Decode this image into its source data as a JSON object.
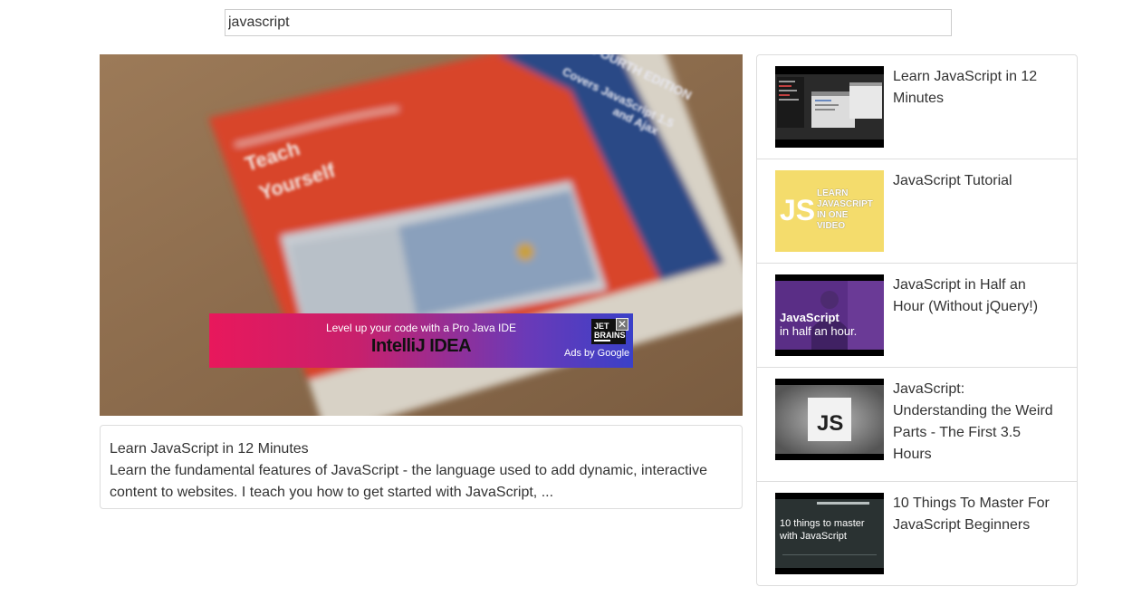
{
  "search": {
    "value": "javascript"
  },
  "player": {
    "ad": {
      "tagline": "Level up your code with a Pro Java IDE",
      "product": "IntelliJ IDEA",
      "logo_line1": "JET",
      "logo_line2": "BRAINS",
      "close_glyph": "✕",
      "attribution": "Ads by Google"
    },
    "book_text": {
      "edition": "FOURTH EDITION",
      "covers_line1": "Covers JavaScript 1.5",
      "covers_line2": "and Ajax",
      "teach": "Teach",
      "yourself": "Yourself"
    }
  },
  "selected_video": {
    "title": "Learn JavaScript in 12 Minutes",
    "description": "Learn the fundamental features of JavaScript - the language used to add dynamic, interactive content to websites. I teach you how to get started with JavaScript, ..."
  },
  "video_list": [
    {
      "title": "Learn JavaScript in 12 Minutes",
      "thumb": "code-editor-screenshot"
    },
    {
      "title": "JavaScript Tutorial",
      "thumb": "js-logo-yellow",
      "thumb_big": "JS",
      "thumb_lines": [
        "LEARN",
        "JAVASCRIPT",
        "IN ONE",
        "VIDEO"
      ]
    },
    {
      "title": "JavaScript in Half an Hour (Without jQuery!)",
      "thumb": "presenter-purple",
      "thumb_line1": "JavaScript",
      "thumb_line2": "in half an hour."
    },
    {
      "title": "JavaScript: Understanding the Weird Parts - The First 3.5 Hours",
      "thumb": "js-square-gray",
      "thumb_big": "JS"
    },
    {
      "title": "10 Things To Master For JavaScript Beginners",
      "thumb": "dark-slide",
      "thumb_line1": "10 things to master",
      "thumb_line2": "with JavaScript"
    }
  ],
  "colors": {
    "border": "#dddddd",
    "text": "#333333",
    "js_yellow": "#f4dc6c",
    "ad_pink": "#e8185c",
    "ad_blue": "#3a40c8"
  }
}
